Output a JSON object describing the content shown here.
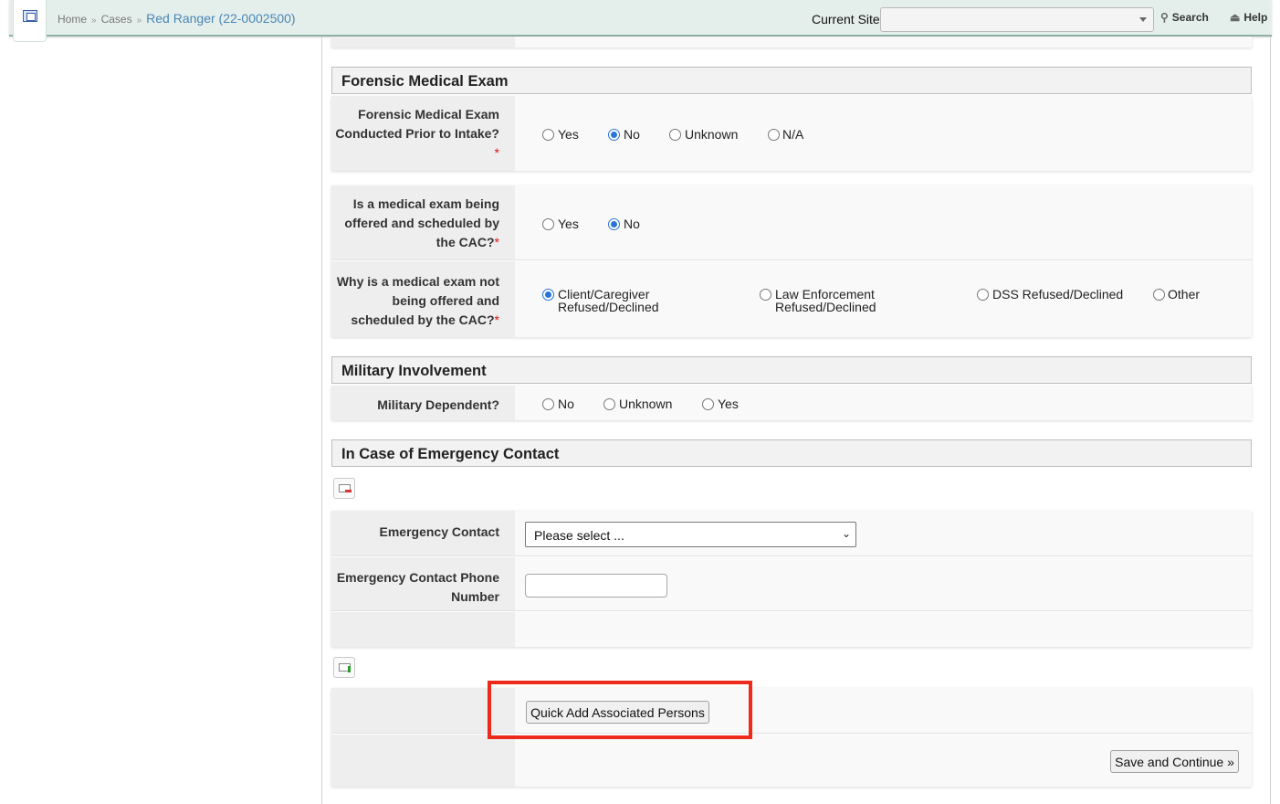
{
  "topbar": {
    "breadcrumb": {
      "home": "Home",
      "cases": "Cases",
      "current": "Red Ranger (22-0002500)"
    },
    "current_site_label": "Current Site",
    "site_value": "",
    "search_label": "Search",
    "help_label": "Help"
  },
  "forensic": {
    "header": "Forensic Medical Exam",
    "q1": {
      "label": "Forensic Medical Exam Conducted Prior to Intake?",
      "required_mark": "*",
      "options": [
        "Yes",
        "No",
        "Unknown",
        "N/A"
      ],
      "selected": "No"
    },
    "q2": {
      "label": "Is a medical exam being offered and scheduled by the CAC?",
      "required_mark": "*",
      "options": [
        "Yes",
        "No"
      ],
      "selected": "No"
    },
    "q3": {
      "label": "Why is a medical exam not being offered and scheduled by the CAC?",
      "required_mark": "*",
      "options": [
        {
          "line1": "Client/Caregiver",
          "line2": "Refused/Declined"
        },
        {
          "line1": "Law Enforcement",
          "line2": "Refused/Declined"
        },
        {
          "line1": "DSS Refused/Declined",
          "line2": ""
        },
        {
          "line1": "Other",
          "line2": ""
        }
      ],
      "selected": "Client/Caregiver Refused/Declined"
    }
  },
  "military": {
    "header": "Military Involvement",
    "label": "Military Dependent?",
    "options": [
      "No",
      "Unknown",
      "Yes"
    ],
    "selected": ""
  },
  "emergency": {
    "header": "In Case of Emergency Contact",
    "contact_label": "Emergency Contact",
    "contact_value": "Please select ...",
    "phone_label": "Emergency Contact Phone Number",
    "phone_value": "",
    "remove_icon": "remove-card-icon",
    "add_icon": "add-card-icon"
  },
  "actions": {
    "quick_add_label": "Quick Add Associated Persons",
    "save_label": "Save and Continue »"
  },
  "colors": {
    "topbar_bg": "#e4efec",
    "link": "#4a86b5",
    "radio_selected": "#2a73d9",
    "highlight": "#ee2a1a",
    "required": "#dd1111"
  }
}
